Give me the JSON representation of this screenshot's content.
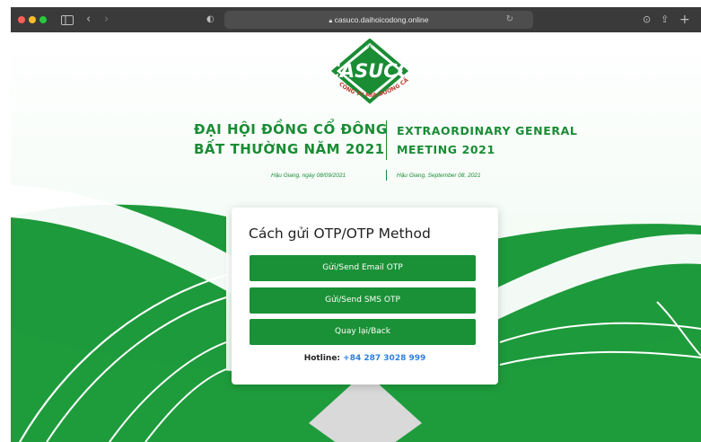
{
  "browser": {
    "url": "casuco.daihoicodong.online"
  },
  "logo": {
    "brand": "CASUCO",
    "registered": "®",
    "tagline": "CÔNG TY MÍA ĐƯỜNG CẦN THƠ"
  },
  "header": {
    "vn_line1": "ĐẠI HỘI ĐỒNG CỔ ĐÔNG",
    "vn_line2": "BẤT THƯỜNG NĂM 2021",
    "en_line1": "EXTRAORDINARY GENERAL",
    "en_line2": "MEETING 2021",
    "date_vn": "Hậu Giang, ngày 08/09/2021",
    "date_en": "Hậu Giang, September 08, 2021"
  },
  "card": {
    "title": "Cách gửi OTP/OTP Method",
    "email_button": "Gửi/Send Email OTP",
    "sms_button": "Gửi/Send SMS OTP",
    "back_button": "Quay lại/Back",
    "hotline_label": "Hotline:",
    "hotline_number": "+84 287 3028 999"
  },
  "colors": {
    "brand_green": "#1a8c34",
    "button_green": "#1a9136",
    "link_blue": "#2f7fe0"
  }
}
